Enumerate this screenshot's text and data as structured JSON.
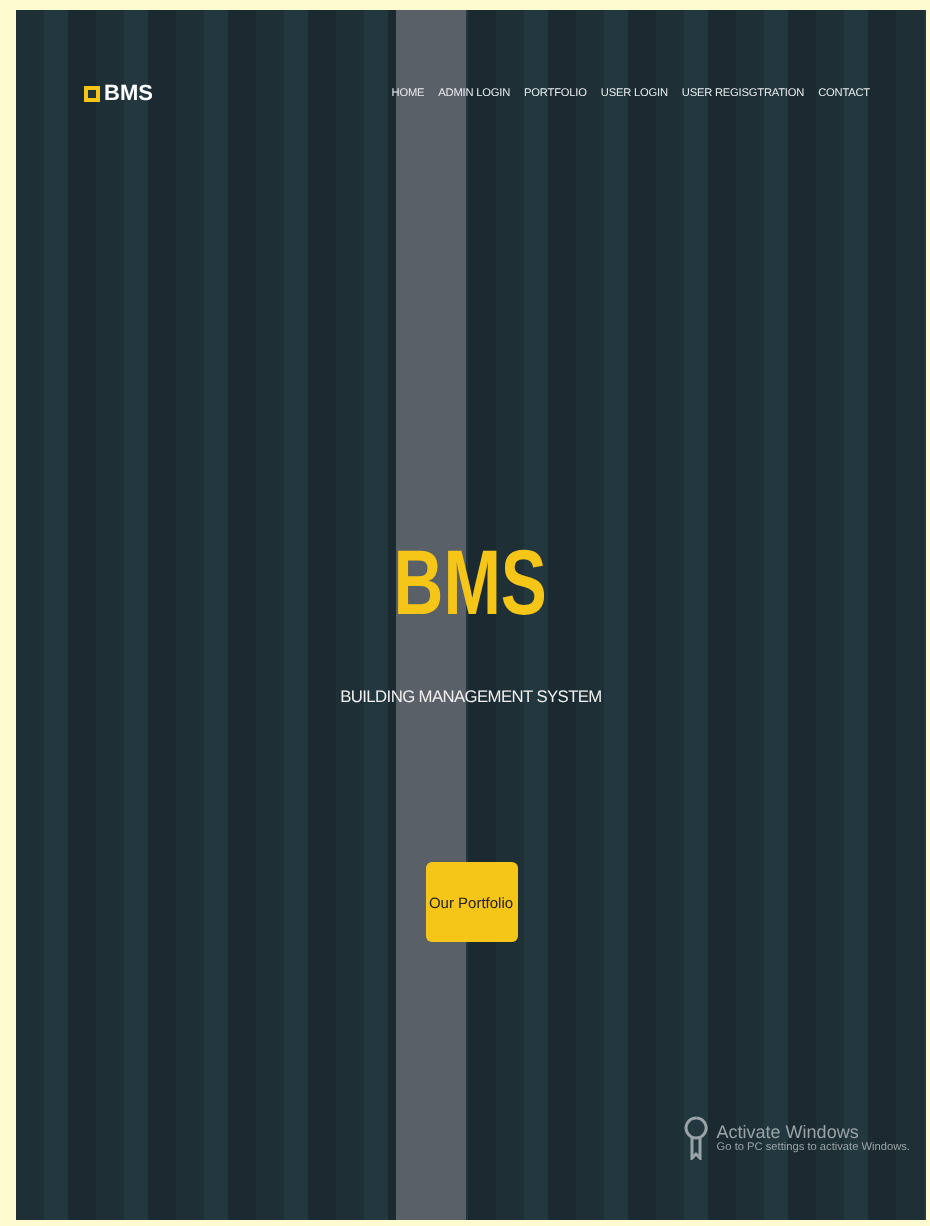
{
  "navbar": {
    "brand": "BMS",
    "links": [
      {
        "label": "HOME"
      },
      {
        "label": "ADMIN LOGIN"
      },
      {
        "label": "PORTFOLIO"
      },
      {
        "label": "USER LOGIN"
      },
      {
        "label": "USER REGISGTRATION"
      },
      {
        "label": "CONTACT"
      }
    ]
  },
  "hero": {
    "title": "BMS",
    "subtitle": "BUILDING MANAGEMENT SYSTEM",
    "button": "Our Portfolio"
  },
  "os_notice": {
    "title": "Activate Windows",
    "text": "Go to PC settings to activate Windows."
  }
}
